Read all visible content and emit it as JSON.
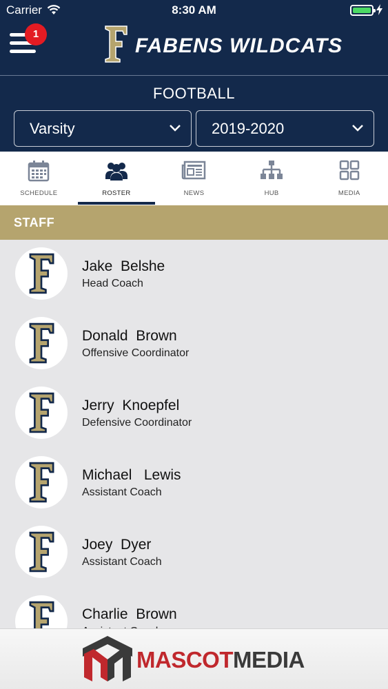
{
  "status": {
    "carrier": "Carrier",
    "time": "8:30 AM"
  },
  "header": {
    "title": "FABENS WILDCATS",
    "notification_count": "1",
    "sport": "FOOTBALL",
    "level": "Varsity",
    "season": "2019-2020"
  },
  "tabs": [
    {
      "label": "SCHEDULE",
      "icon": "calendar-icon"
    },
    {
      "label": "ROSTER",
      "icon": "people-icon"
    },
    {
      "label": "NEWS",
      "icon": "newspaper-icon"
    },
    {
      "label": "HUB",
      "icon": "hierarchy-icon"
    },
    {
      "label": "MEDIA",
      "icon": "grid-icon"
    }
  ],
  "active_tab": "ROSTER",
  "section_title": "STAFF",
  "staff": [
    {
      "name": "Jake  Belshe",
      "role": "Head Coach"
    },
    {
      "name": "Donald  Brown",
      "role": "Offensive Coordinator"
    },
    {
      "name": "Jerry  Knoepfel",
      "role": "Defensive Coordinator"
    },
    {
      "name": "Michael   Lewis",
      "role": "Assistant Coach"
    },
    {
      "name": "Joey  Dyer",
      "role": "Assistant Coach"
    },
    {
      "name": "Charlie  Brown",
      "role": "Assistant Coach"
    }
  ],
  "footer": {
    "brand_part1": "MASCOT",
    "brand_part2": "MEDIA"
  },
  "colors": {
    "navy": "#13294b",
    "gold": "#b5a46e",
    "red": "#c0282d",
    "badge": "#e31b23",
    "battery": "#4cd964"
  }
}
